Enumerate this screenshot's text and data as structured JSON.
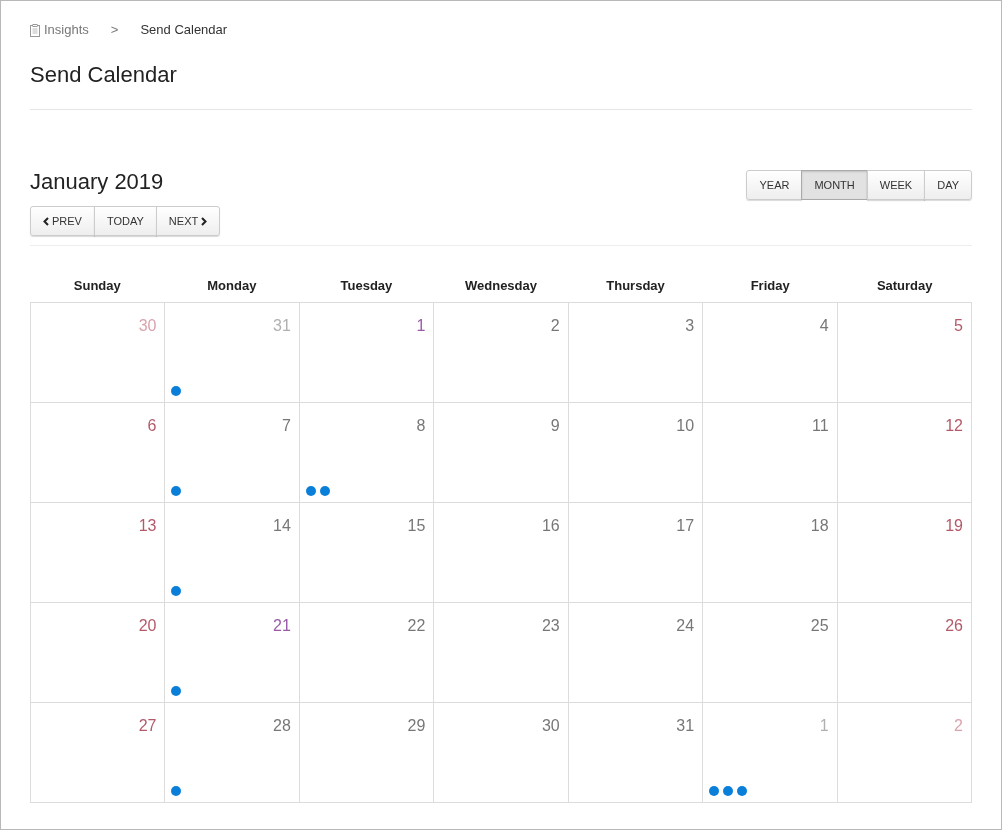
{
  "breadcrumb": {
    "parent": "Insights",
    "separator": ">",
    "current": "Send Calendar"
  },
  "title": "Send Calendar",
  "month_label": "January 2019",
  "nav_buttons": [
    {
      "kind": "prev",
      "label": "PREV"
    },
    {
      "kind": "today",
      "label": "TODAY"
    },
    {
      "kind": "next",
      "label": "NEXT"
    }
  ],
  "view_tabs": [
    {
      "label": "YEAR",
      "selected": false
    },
    {
      "label": "MONTH",
      "selected": true
    },
    {
      "label": "WEEK",
      "selected": false
    },
    {
      "label": "DAY",
      "selected": false
    }
  ],
  "weekdays": [
    "Sunday",
    "Monday",
    "Tuesday",
    "Wednesday",
    "Thursday",
    "Friday",
    "Saturday"
  ],
  "weeks": [
    [
      {
        "day": "30",
        "in_month": false,
        "kind": "weekend"
      },
      {
        "day": "31",
        "in_month": false,
        "kind": "weekday",
        "sends": [
          {
            "kind": "send"
          }
        ]
      },
      {
        "day": "1",
        "in_month": true,
        "kind": "holiday"
      },
      {
        "day": "2",
        "in_month": true,
        "kind": "weekday"
      },
      {
        "day": "3",
        "in_month": true,
        "kind": "weekday"
      },
      {
        "day": "4",
        "in_month": true,
        "kind": "weekday"
      },
      {
        "day": "5",
        "in_month": true,
        "kind": "weekend"
      }
    ],
    [
      {
        "day": "6",
        "in_month": true,
        "kind": "weekend"
      },
      {
        "day": "7",
        "in_month": true,
        "kind": "weekday",
        "sends": [
          {
            "kind": "send"
          }
        ]
      },
      {
        "day": "8",
        "in_month": true,
        "kind": "weekday",
        "sends": [
          {
            "kind": "send"
          },
          {
            "kind": "send"
          }
        ]
      },
      {
        "day": "9",
        "in_month": true,
        "kind": "weekday"
      },
      {
        "day": "10",
        "in_month": true,
        "kind": "weekday"
      },
      {
        "day": "11",
        "in_month": true,
        "kind": "weekday"
      },
      {
        "day": "12",
        "in_month": true,
        "kind": "weekend"
      }
    ],
    [
      {
        "day": "13",
        "in_month": true,
        "kind": "weekend"
      },
      {
        "day": "14",
        "in_month": true,
        "kind": "weekday",
        "sends": [
          {
            "kind": "send"
          }
        ]
      },
      {
        "day": "15",
        "in_month": true,
        "kind": "weekday"
      },
      {
        "day": "16",
        "in_month": true,
        "kind": "weekday"
      },
      {
        "day": "17",
        "in_month": true,
        "kind": "weekday"
      },
      {
        "day": "18",
        "in_month": true,
        "kind": "weekday"
      },
      {
        "day": "19",
        "in_month": true,
        "kind": "weekend"
      }
    ],
    [
      {
        "day": "20",
        "in_month": true,
        "kind": "weekend"
      },
      {
        "day": "21",
        "in_month": true,
        "kind": "holiday",
        "sends": [
          {
            "kind": "send"
          }
        ]
      },
      {
        "day": "22",
        "in_month": true,
        "kind": "weekday"
      },
      {
        "day": "23",
        "in_month": true,
        "kind": "weekday"
      },
      {
        "day": "24",
        "in_month": true,
        "kind": "weekday"
      },
      {
        "day": "25",
        "in_month": true,
        "kind": "weekday"
      },
      {
        "day": "26",
        "in_month": true,
        "kind": "weekend"
      }
    ],
    [
      {
        "day": "27",
        "in_month": true,
        "kind": "weekend"
      },
      {
        "day": "28",
        "in_month": true,
        "kind": "weekday",
        "sends": [
          {
            "kind": "send"
          }
        ]
      },
      {
        "day": "29",
        "in_month": true,
        "kind": "weekday"
      },
      {
        "day": "30",
        "in_month": true,
        "kind": "weekday"
      },
      {
        "day": "31",
        "in_month": true,
        "kind": "weekday"
      },
      {
        "day": "1",
        "in_month": false,
        "kind": "weekday",
        "sends": [
          {
            "kind": "send"
          },
          {
            "kind": "send"
          },
          {
            "kind": "send"
          }
        ]
      },
      {
        "day": "2",
        "in_month": false,
        "kind": "weekend"
      }
    ]
  ]
}
